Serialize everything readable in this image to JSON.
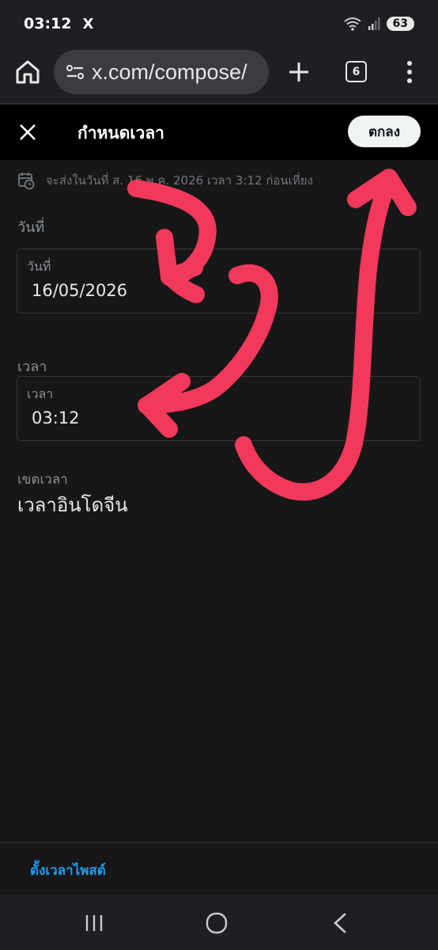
{
  "status_bar": {
    "time": "03:12",
    "app_icon": "X",
    "battery": "63"
  },
  "browser": {
    "url": "x.com/compose/",
    "tab_count": "6"
  },
  "header": {
    "title": "กำหนดเวลา",
    "confirm_label": "ตกลง"
  },
  "schedule_info": {
    "text": "จะส่งในวันที่ ส. 16 พ.ค. 2026 เวลา 3:12 ก่อนเที่ยง"
  },
  "date_section": {
    "label": "วันที่",
    "field_label": "วันที่",
    "value": "16/05/2026"
  },
  "time_section": {
    "label": "เวลา",
    "field_label": "เวลา",
    "value": "03:12"
  },
  "timezone": {
    "label": "เขตเวลา",
    "value": "เวลาอินโดจีน"
  },
  "footer": {
    "scheduled_posts_label": "ตั้งเวลาไพสต์"
  },
  "colors": {
    "accent": "#1d9bf0",
    "annotation": "#f2385b",
    "background": "#171717"
  }
}
